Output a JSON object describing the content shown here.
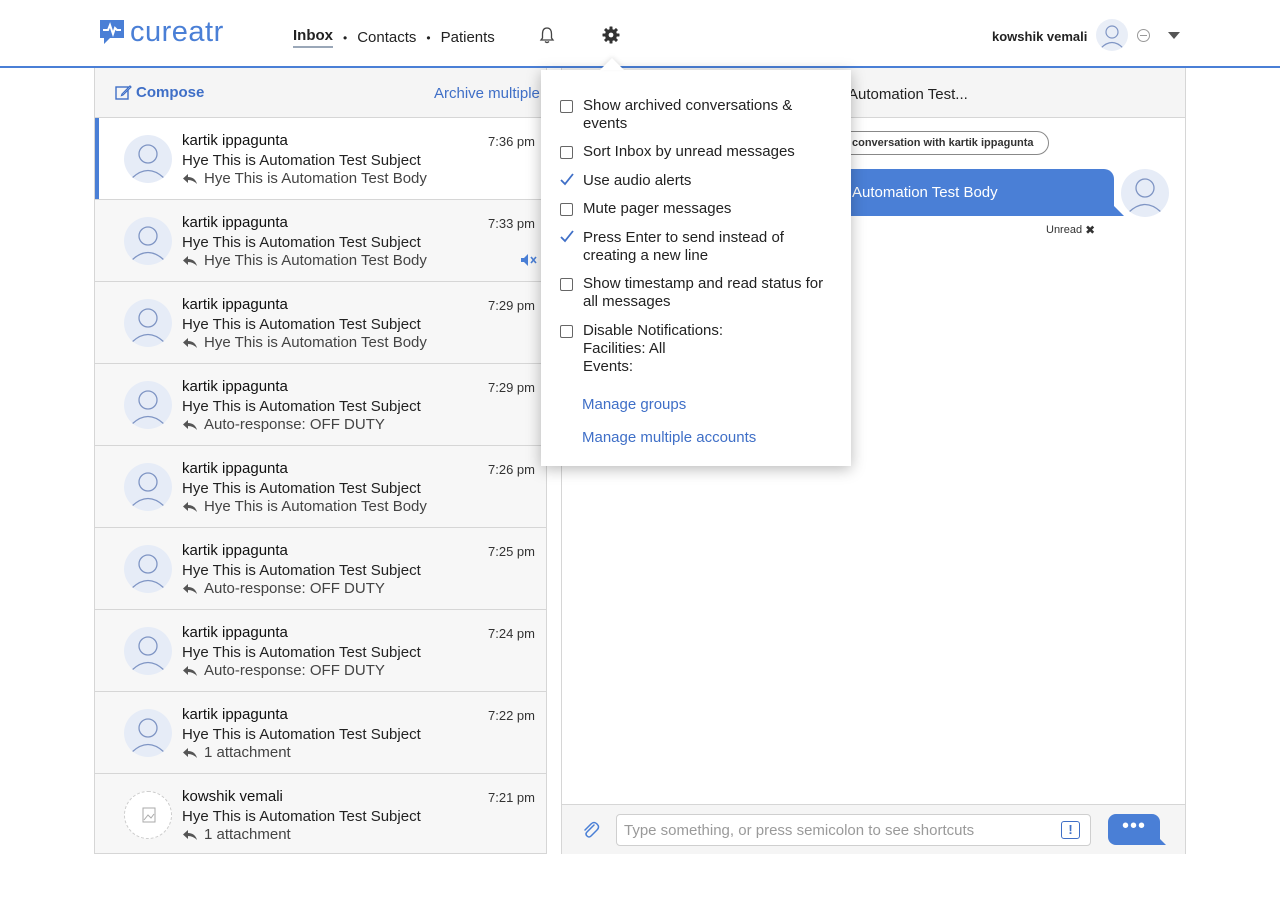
{
  "brand": {
    "name": "cureatr",
    "color": "#4a7fd6"
  },
  "nav": {
    "items": [
      "Inbox",
      "Contacts",
      "Patients"
    ],
    "separator": "•",
    "active": "Inbox"
  },
  "header_icons": [
    "bell-icon",
    "gear-icon"
  ],
  "user": {
    "name": "kowshik vemali"
  },
  "inbox": {
    "compose_label": "Compose",
    "archive_label": "Archive multiple",
    "conversations": [
      {
        "name": "kartik ippagunta",
        "subject": "Hye This is Automation Test Subject",
        "preview": "Hye This is Automation Test Body",
        "time": "7:36 pm"
      },
      {
        "name": "kartik ippagunta",
        "subject": "Hye This is Automation Test Subject",
        "preview": "Hye This is Automation Test Body",
        "time": "7:33 pm"
      },
      {
        "name": "kartik ippagunta",
        "subject": "Hye This is Automation Test Subject",
        "preview": "Hye This is Automation Test Body",
        "time": "7:29 pm"
      },
      {
        "name": "kartik ippagunta",
        "subject": "Hye This is Automation Test Subject",
        "preview": "Auto-response: OFF DUTY",
        "time": "7:29 pm"
      },
      {
        "name": "kartik ippagunta",
        "subject": "Hye This is Automation Test Subject",
        "preview": "Hye This is Automation Test Body",
        "time": "7:26 pm"
      },
      {
        "name": "kartik ippagunta",
        "subject": "Hye This is Automation Test Subject",
        "preview": "Auto-response: OFF DUTY",
        "time": "7:25 pm"
      },
      {
        "name": "kartik ippagunta",
        "subject": "Hye This is Automation Test Subject",
        "preview": "Auto-response: OFF DUTY",
        "time": "7:24 pm"
      },
      {
        "name": "kartik ippagunta",
        "subject": "Hye This is Automation Test Subject",
        "preview": "1 attachment",
        "time": "7:22 pm"
      },
      {
        "name": "kowshik vemali",
        "subject": "Hye This is Automation Test Subject",
        "preview": "1 attachment",
        "time": "7:21 pm"
      }
    ]
  },
  "conversation": {
    "title": "Automation Test...",
    "pill": "conversation with kartik ippagunta",
    "message": "Automation Test Body",
    "unread_label": "Unread",
    "unread_close": "✖",
    "input_placeholder": "Type something, or press semicolon to see shortcuts",
    "urgent_symbol": "!",
    "send_label": "•••"
  },
  "settings": {
    "options": [
      {
        "label": "Show archived conversations & events",
        "checked": false
      },
      {
        "label": "Sort Inbox by unread messages",
        "checked": false
      },
      {
        "label": "Use audio alerts",
        "checked": true
      },
      {
        "label": "Mute pager messages",
        "checked": false
      },
      {
        "label": "Press Enter to send instead of creating a new line",
        "checked": true
      },
      {
        "label": "Show timestamp and read status for all messages",
        "checked": false
      },
      {
        "label": "Disable Notifications:",
        "checked": false,
        "details": [
          "Facilities: All",
          "Events:"
        ]
      }
    ],
    "links": [
      "Manage groups",
      "Manage multiple accounts"
    ]
  },
  "colors": {
    "accent": "#4a7fd6",
    "link": "#3f6fc7",
    "selected_bar": "#4a7fd6"
  }
}
